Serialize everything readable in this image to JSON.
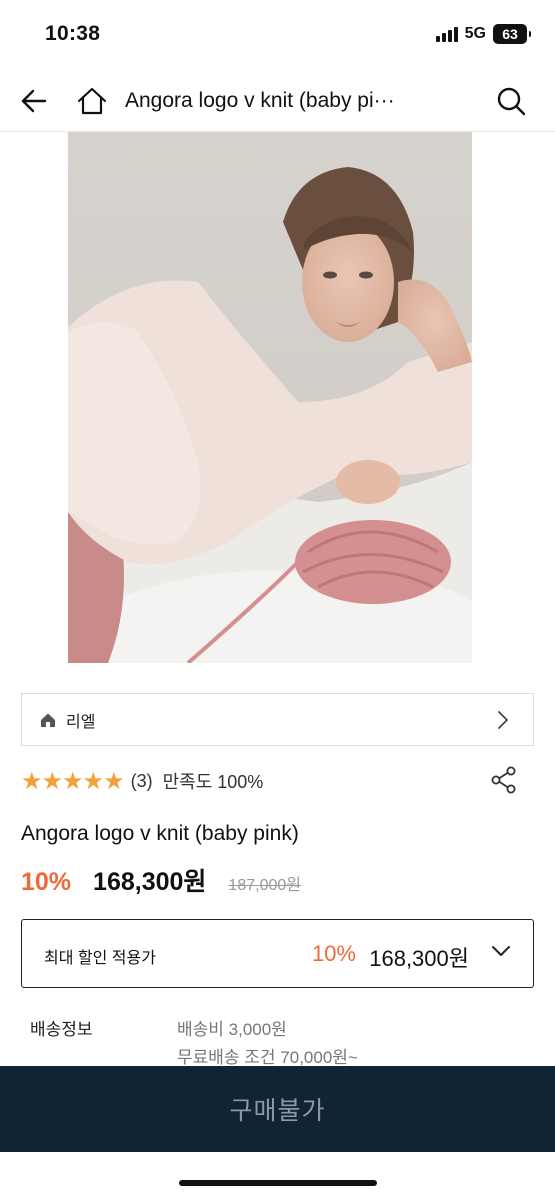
{
  "status": {
    "time": "10:38",
    "network": "5G",
    "battery": "63"
  },
  "nav": {
    "title": "Angora logo v knit (baby pi···",
    "icons": [
      "back-arrow-icon",
      "home-icon",
      "search-icon"
    ]
  },
  "brand": {
    "name": "리엘",
    "icon": "home-icon"
  },
  "rating": {
    "stars": "★★★★★",
    "count": "(3)",
    "satisfaction": "만족도 100%"
  },
  "product": {
    "name": "Angora logo v knit (baby pink)",
    "discount_rate": "10%",
    "sale_price": "168,300원",
    "original_price": "187,000원"
  },
  "max_discount": {
    "label": "최대 할인 적용가",
    "rate": "10%",
    "price": "168,300원"
  },
  "shipping": {
    "label": "배송정보",
    "fee": "배송비 3,000원",
    "free_condition": "무료배송 조건 70,000원~"
  },
  "buy": {
    "label": "구매불가"
  },
  "colors": {
    "accent": "#ef6a3a",
    "star": "#f3a13b",
    "buy_bar": "#102436"
  }
}
